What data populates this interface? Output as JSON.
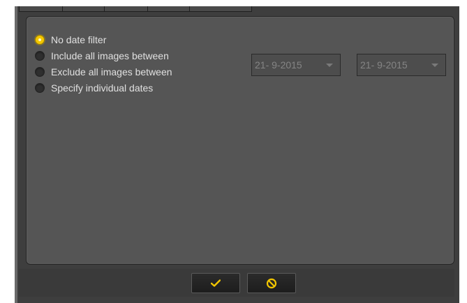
{
  "filter_options": [
    {
      "label": "No date filter",
      "selected": true
    },
    {
      "label": "Include all images between",
      "selected": false
    },
    {
      "label": "Exclude all images between",
      "selected": false
    },
    {
      "label": "Specify individual dates",
      "selected": false
    }
  ],
  "date_range": {
    "start": "21- 9-2015",
    "separator": "-",
    "end": "21- 9-2015"
  },
  "buttons": {
    "ok_icon": "checkmark-icon",
    "cancel_icon": "cancel-icon"
  },
  "colors": {
    "accent": "#f2c600",
    "panel_bg": "#555555",
    "window_bg": "#3e3e3e"
  }
}
